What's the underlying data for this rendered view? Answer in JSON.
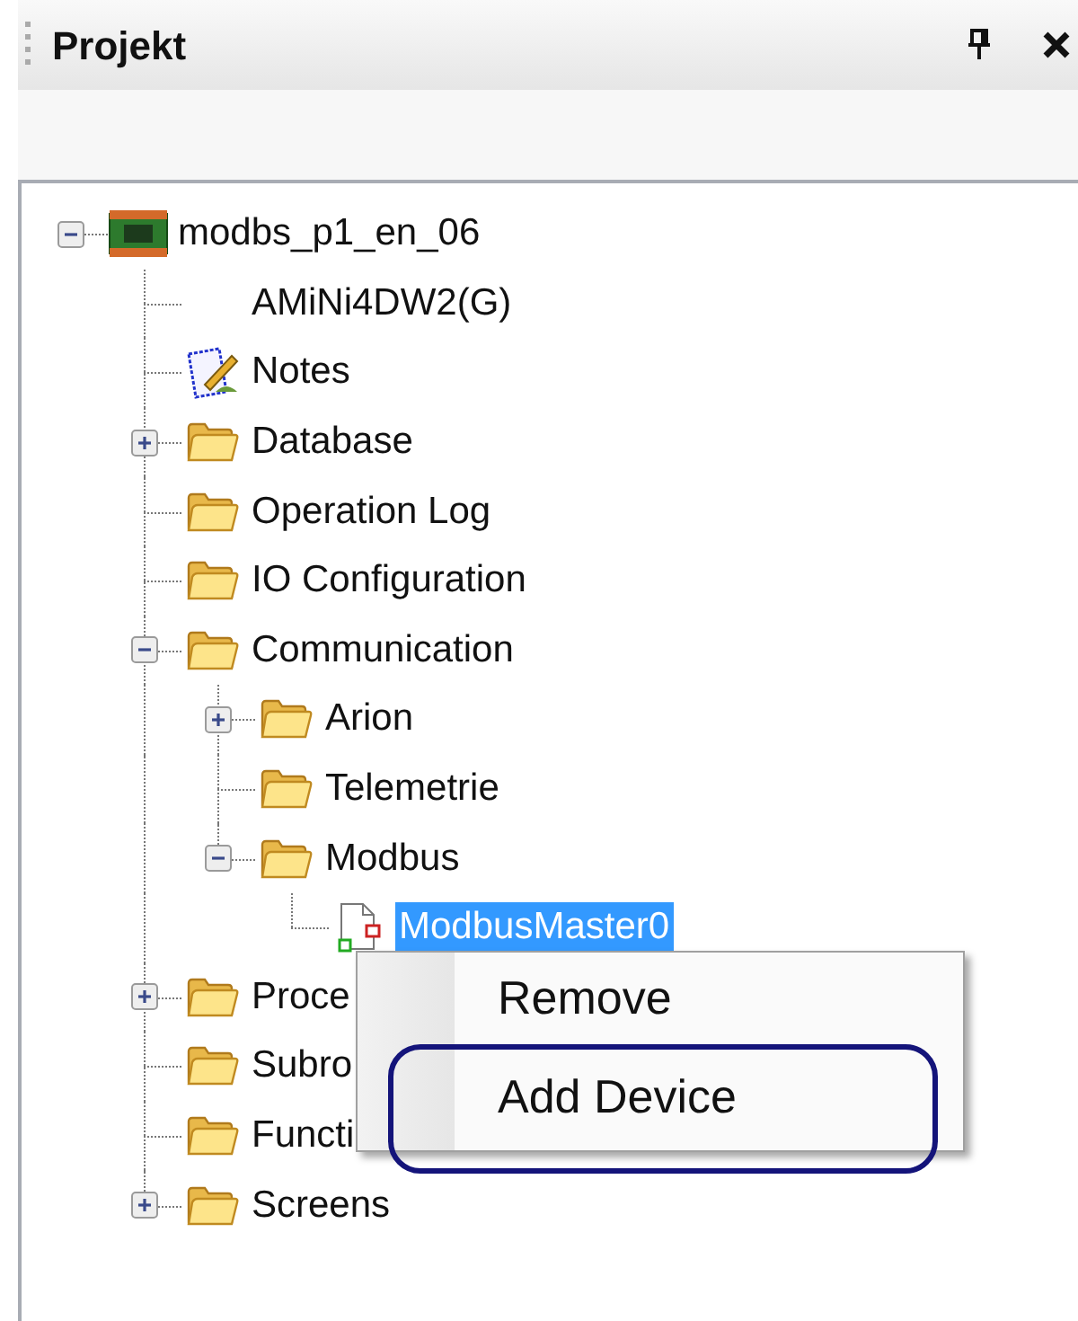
{
  "panel": {
    "title": "Projekt"
  },
  "tree": [
    {
      "label": "modbs_p1_en_06",
      "kind": "device",
      "expanded": true,
      "selected": false,
      "children": [
        {
          "label": "AMiNi4DW2(G)",
          "kind": "none",
          "selected": false
        },
        {
          "label": "Notes",
          "kind": "notes",
          "selected": false
        },
        {
          "label": "Database",
          "kind": "folder",
          "expanded": false,
          "selected": false
        },
        {
          "label": "Operation Log",
          "kind": "folder",
          "selected": false
        },
        {
          "label": "IO Configuration",
          "kind": "folder",
          "selected": false
        },
        {
          "label": "Communication",
          "kind": "folder",
          "expanded": true,
          "selected": false,
          "children": [
            {
              "label": "Arion",
              "kind": "folder",
              "expanded": false,
              "selected": false
            },
            {
              "label": "Telemetrie",
              "kind": "folder",
              "selected": false
            },
            {
              "label": "Modbus",
              "kind": "folder",
              "expanded": true,
              "selected": false,
              "children": [
                {
                  "label": "ModbusMaster0",
                  "kind": "modbus-file",
                  "selected": true
                }
              ]
            }
          ]
        },
        {
          "label": "Proce",
          "kind": "folder",
          "expanded": false,
          "selected": false
        },
        {
          "label": "Subro",
          "kind": "folder",
          "selected": false
        },
        {
          "label": "Functi",
          "kind": "folder",
          "selected": false
        },
        {
          "label": "Screens",
          "kind": "folder",
          "expanded": false,
          "selected": false
        }
      ]
    }
  ],
  "context_menu": {
    "items": [
      {
        "label": "Remove",
        "highlighted": false
      },
      {
        "label": "Add Device",
        "highlighted": true
      }
    ]
  }
}
